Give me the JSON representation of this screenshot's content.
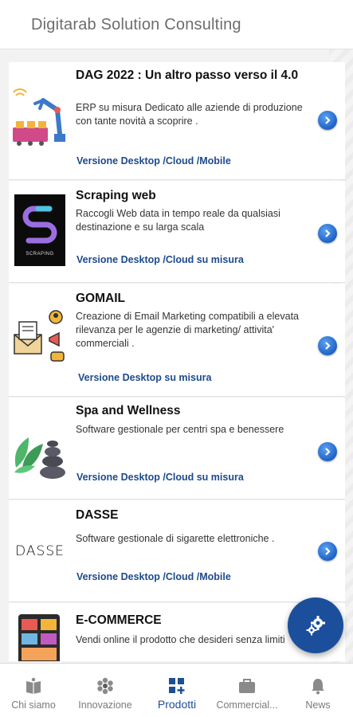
{
  "header": {
    "title": "Digitarab Solution Consulting"
  },
  "products": [
    {
      "title": "DAG 2022 : Un altro passo verso il 4.0",
      "description": "ERP su misura Dedicato alle aziende di produzione con tante novità a scoprire .",
      "versions": "Versione Desktop /Cloud /Mobile",
      "image": "robotic-arm-factory-icon"
    },
    {
      "title": "Scraping web",
      "description": "Raccogli Web data in tempo reale da qualsiasi destinazione e su larga scala",
      "versions": "Versione Desktop /Cloud  su misura",
      "image": "scraping-logo",
      "logo_caption": "SCRAPING"
    },
    {
      "title": "GOMAIL",
      "description": "Creazione di Email Marketing compatibili a elevata rilevanza per le agenzie di marketing/ attivita' commerciali .",
      "versions": "Versione Desktop su misura",
      "image": "email-marketing-icon"
    },
    {
      "title": "Spa and Wellness",
      "description": "Software gestionale per  centri spa e benessere",
      "versions": "Versione Desktop /Cloud  su misura",
      "image": "spa-stones-icon"
    },
    {
      "title": "DASSE",
      "description": "Software gestionale di sigarette elettroniche .",
      "versions": "Versione Desktop /Cloud /Mobile",
      "image": "dasse-logo",
      "logo_text": "DASSE"
    },
    {
      "title": "E-COMMERCE",
      "description": "Vendi online il prodotto che desideri senza limiti",
      "versions": "",
      "image": "ecommerce-icon"
    }
  ],
  "fab": {
    "icon": "gear-icon"
  },
  "bottom_nav": [
    {
      "label": "Chi siamo",
      "icon": "book-icon"
    },
    {
      "label": "Innovazione",
      "icon": "flower-icon"
    },
    {
      "label": "Prodotti",
      "icon": "grid-plus-icon",
      "active": true
    },
    {
      "label": "Commercial...",
      "icon": "briefcase-icon"
    },
    {
      "label": "News",
      "icon": "bell-icon"
    }
  ],
  "colors": {
    "accent": "#1e4f96",
    "link": "#1d4a8c",
    "fab": "#1b4f9c"
  }
}
